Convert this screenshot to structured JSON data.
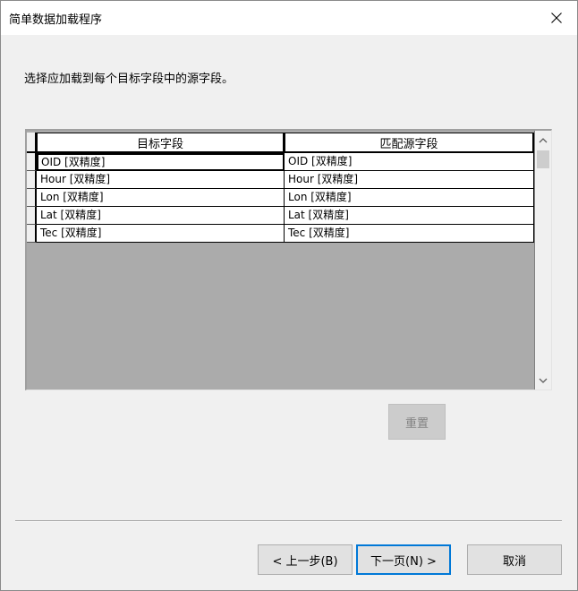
{
  "window": {
    "title": "简单数据加载程序"
  },
  "instruction": "选择应加载到每个目标字段中的源字段。",
  "grid": {
    "columns": {
      "target": "目标字段",
      "source": "匹配源字段"
    },
    "rows": [
      {
        "target": "OID [双精度]",
        "source": "OID [双精度]"
      },
      {
        "target": "Hour [双精度]",
        "source": "Hour [双精度]"
      },
      {
        "target": "Lon [双精度]",
        "source": "Lon [双精度]"
      },
      {
        "target": "Lat [双精度]",
        "source": "Lat [双精度]"
      },
      {
        "target": "Tec [双精度]",
        "source": "Tec [双精度]"
      }
    ]
  },
  "buttons": {
    "reset": "重置",
    "prev": "< 上一步(B)",
    "next": "下一页(N) >",
    "cancel": "取消"
  },
  "icons": {
    "close": "close-icon",
    "scroll_up": "chevron-up-icon",
    "scroll_down": "chevron-down-icon"
  },
  "colors": {
    "focus_border": "#0078d7",
    "disabled_text": "#838383"
  }
}
